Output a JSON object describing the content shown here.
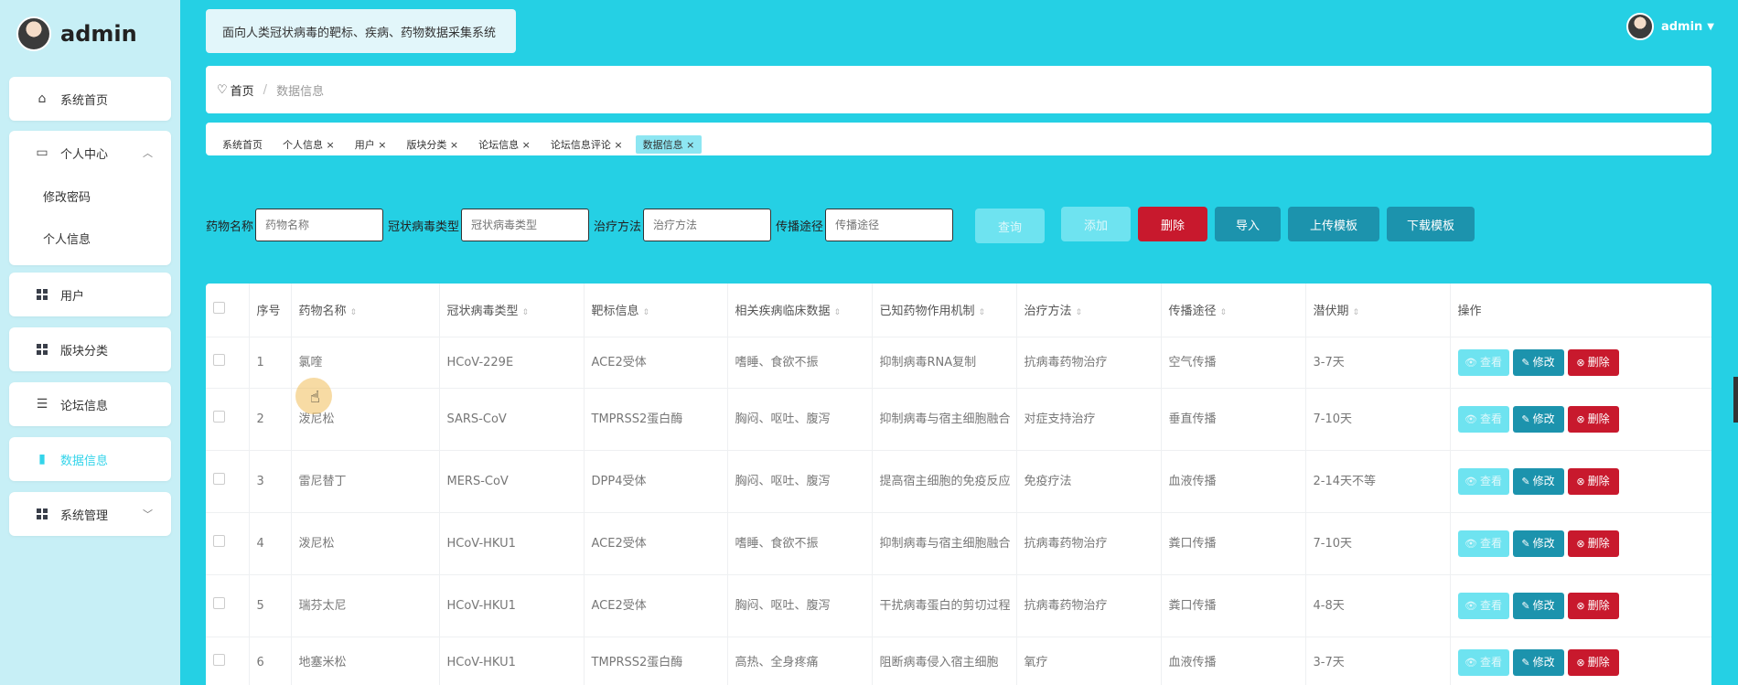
{
  "sidebar": {
    "username": "admin",
    "items": [
      {
        "label": "系统首页",
        "icon": "home-icon"
      },
      {
        "label": "个人中心",
        "icon": "wallet-icon"
      },
      {
        "label": "修改密码"
      },
      {
        "label": "个人信息"
      },
      {
        "label": "用户",
        "icon": "grid-icon"
      },
      {
        "label": "版块分类",
        "icon": "grid-icon"
      },
      {
        "label": "论坛信息",
        "icon": "sliders-icon"
      },
      {
        "label": "数据信息",
        "icon": "chart-icon"
      },
      {
        "label": "系统管理",
        "icon": "grid-icon"
      }
    ],
    "active_color": "#33d4ea"
  },
  "header": {
    "system_title": "面向人类冠状病毒的靶标、疾病、药物数据采集系统",
    "user_name": "admin",
    "user_caret": "▼"
  },
  "breadcrumb": {
    "home": "首页",
    "sep": "/",
    "current": "数据信息"
  },
  "tags": [
    {
      "label": "系统首页"
    },
    {
      "label": "个人信息 ×"
    },
    {
      "label": "用户 ×"
    },
    {
      "label": "版块分类 ×"
    },
    {
      "label": "论坛信息 ×"
    },
    {
      "label": "论坛信息评论 ×"
    },
    {
      "label": "数据信息 ×"
    }
  ],
  "search": {
    "drug_label": "药物名称",
    "drug_placeholder": "药物名称",
    "virus_label": "冠状病毒类型",
    "virus_placeholder": "冠状病毒类型",
    "treat_label": "治疗方法",
    "treat_placeholder": "治疗方法",
    "spread_label": "传播途径",
    "spread_placeholder": "传播途径"
  },
  "buttons": {
    "query": "查询",
    "add": "添加",
    "delete": "删除",
    "import": "导入",
    "upload": "上传模板",
    "download": "下载模板"
  },
  "table": {
    "headers": [
      "序号",
      "药物名称",
      "冠状病毒类型",
      "靶标信息",
      "相关疾病临床数据",
      "已知药物作用机制",
      "治疗方法",
      "传播途径",
      "潜伏期",
      "操作"
    ],
    "sort_glyph": "⇕",
    "rows": [
      {
        "no": "1",
        "drug": "氯喹",
        "virus": "HCoV-229E",
        "target": "ACE2受体",
        "clinical": "嗜睡、食欲不振",
        "mech": "抑制病毒RNA复制",
        "treat": "抗病毒药物治疗",
        "spread": "空气传播",
        "incub": "3-7天"
      },
      {
        "no": "2",
        "drug": "泼尼松",
        "virus": "SARS-CoV",
        "target": "TMPRSS2蛋白酶",
        "clinical": "胸闷、呕吐、腹泻",
        "mech": "抑制病毒与宿主细胞融合",
        "treat": "对症支持治疗",
        "spread": "垂直传播",
        "incub": "7-10天"
      },
      {
        "no": "3",
        "drug": "雷尼替丁",
        "virus": "MERS-CoV",
        "target": "DPP4受体",
        "clinical": "胸闷、呕吐、腹泻",
        "mech": "提高宿主细胞的免疫反应",
        "treat": "免疫疗法",
        "spread": "血液传播",
        "incub": "2-14天不等"
      },
      {
        "no": "4",
        "drug": "泼尼松",
        "virus": "HCoV-HKU1",
        "target": "ACE2受体",
        "clinical": "嗜睡、食欲不振",
        "mech": "抑制病毒与宿主细胞融合",
        "treat": "抗病毒药物治疗",
        "spread": "粪口传播",
        "incub": "7-10天"
      },
      {
        "no": "5",
        "drug": "瑞芬太尼",
        "virus": "HCoV-HKU1",
        "target": "ACE2受体",
        "clinical": "胸闷、呕吐、腹泻",
        "mech": "干扰病毒蛋白的剪切过程",
        "treat": "抗病毒药物治疗",
        "spread": "粪口传播",
        "incub": "4-8天"
      },
      {
        "no": "6",
        "drug": "地塞米松",
        "virus": "HCoV-HKU1",
        "target": "TMPRSS2蛋白酶",
        "clinical": "高热、全身疼痛",
        "mech": "阻断病毒侵入宿主细胞",
        "treat": "氧疗",
        "spread": "血液传播",
        "incub": "3-7天"
      }
    ],
    "ops": {
      "view": "查看",
      "edit": "修改",
      "del": "删除"
    }
  }
}
